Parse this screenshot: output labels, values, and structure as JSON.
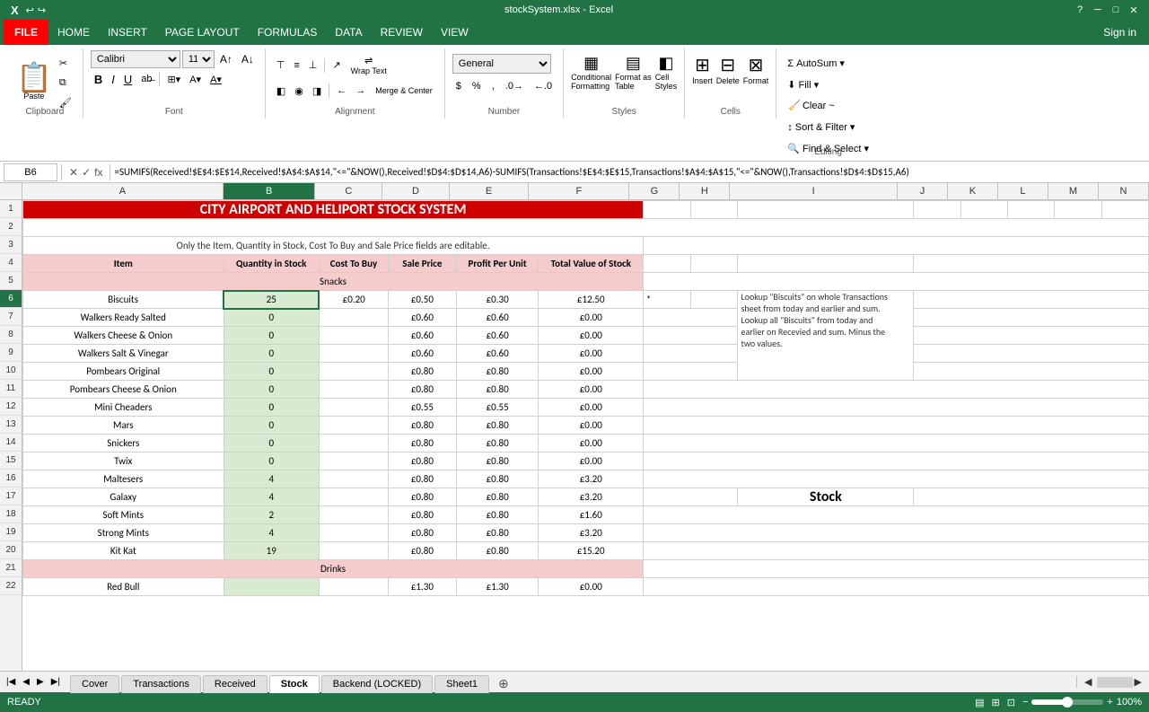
{
  "titleBar": {
    "title": "stockSystem.xlsx - Excel",
    "helpBtn": "?",
    "minBtn": "─",
    "maxBtn": "□",
    "closeBtn": "✕"
  },
  "menuBar": {
    "fileBtn": "FILE",
    "items": [
      "HOME",
      "INSERT",
      "PAGE LAYOUT",
      "FORMULAS",
      "DATA",
      "REVIEW",
      "VIEW"
    ],
    "signIn": "Sign in"
  },
  "ribbon": {
    "clipboard": {
      "label": "Clipboard",
      "pasteLabel": "Paste",
      "cutLabel": "✂",
      "copyLabel": "⧉",
      "formatPainterLabel": "🖌"
    },
    "font": {
      "label": "Font",
      "fontName": "Calibri",
      "fontSize": "11",
      "boldLabel": "B",
      "italicLabel": "I",
      "underlineLabel": "U",
      "strikeLabel": "ab"
    },
    "alignment": {
      "label": "Alignment",
      "wrapText": "Wrap Text",
      "mergeCenter": "Merge & Center"
    },
    "number": {
      "label": "Number",
      "format": "General"
    },
    "styles": {
      "label": "Styles",
      "conditionalFormatting": "Conditional Formatting",
      "formatAsTable": "Format as Table",
      "cellStyles": "Cell Styles"
    },
    "cells": {
      "label": "Cells",
      "insert": "Insert",
      "delete": "Delete",
      "format": "Format"
    },
    "editing": {
      "label": "Editing",
      "autoSum": "AutoSum",
      "fill": "Fill",
      "clear": "Clear ~",
      "sortFilter": "Sort & Filter",
      "findSelect": "Find & Select"
    }
  },
  "formulaBar": {
    "cellRef": "B6",
    "formula": "=SUMIFS(Received!$E$4:$E$14,Received!$A$4:$A$14,\"<=\"&NOW(),Received!$D$4:$D$14,A6)-SUMIFS(Transactions!$E$4:$E$15,Transactions!$A$4:$A$15,\"<=\"&NOW(),Transactions!$D$4:$D$15,A6)"
  },
  "columns": {
    "headers": [
      "A",
      "B",
      "C",
      "D",
      "E",
      "F",
      "G",
      "H",
      "I",
      "J",
      "K",
      "L",
      "M",
      "N"
    ],
    "widths": [
      240,
      110,
      80,
      80,
      95,
      120,
      60,
      60,
      200,
      60,
      60,
      60,
      60,
      60
    ]
  },
  "spreadsheet": {
    "title": "CITY AIRPORT AND HELIPORT STOCK SYSTEM",
    "subtitle": "Only the Item, Quantity in Stock, Cost To Buy and Sale Price fields are editable.",
    "columnHeaders": {
      "item": "Item",
      "quantityInStock": "Quantity in Stock",
      "costToBuy": "Cost To Buy",
      "salePrice": "Sale Price",
      "profitPerUnit": "Profit Per Unit",
      "totalValueOfStock": "Total Value of Stock"
    },
    "sections": {
      "snacks": "Snacks",
      "drinks": "Drinks"
    },
    "rows": [
      {
        "item": "Biscuits",
        "qty": "25",
        "cost": "£0.20",
        "sale": "£0.50",
        "profit": "£0.30",
        "total": "£12.50",
        "isSelected": true
      },
      {
        "item": "Walkers Ready Salted",
        "qty": "0",
        "cost": "",
        "sale": "£0.60",
        "profit": "£0.60",
        "total": "£0.00"
      },
      {
        "item": "Walkers Cheese & Onion",
        "qty": "0",
        "cost": "",
        "sale": "£0.60",
        "profit": "£0.60",
        "total": "£0.00"
      },
      {
        "item": "Walkers Salt & Vinegar",
        "qty": "0",
        "cost": "",
        "sale": "£0.60",
        "profit": "£0.60",
        "total": "£0.00"
      },
      {
        "item": "Pombears Original",
        "qty": "0",
        "cost": "",
        "sale": "£0.80",
        "profit": "£0.80",
        "total": "£0.00"
      },
      {
        "item": "Pombears Cheese & Onion",
        "qty": "0",
        "cost": "",
        "sale": "£0.80",
        "profit": "£0.80",
        "total": "£0.00"
      },
      {
        "item": "Mini Cheaders",
        "qty": "0",
        "cost": "",
        "sale": "£0.55",
        "profit": "£0.55",
        "total": "£0.00"
      },
      {
        "item": "Mars",
        "qty": "0",
        "cost": "",
        "sale": "£0.80",
        "profit": "£0.80",
        "total": "£0.00"
      },
      {
        "item": "Snickers",
        "qty": "0",
        "cost": "",
        "sale": "£0.80",
        "profit": "£0.80",
        "total": "£0.00"
      },
      {
        "item": "Twix",
        "qty": "0",
        "cost": "",
        "sale": "£0.80",
        "profit": "£0.80",
        "total": "£0.00"
      },
      {
        "item": "Maltesers",
        "qty": "4",
        "cost": "",
        "sale": "£0.80",
        "profit": "£0.80",
        "total": "£3.20"
      },
      {
        "item": "Galaxy",
        "qty": "4",
        "cost": "",
        "sale": "£0.80",
        "profit": "£0.80",
        "total": "£3.20"
      },
      {
        "item": "Soft Mints",
        "qty": "2",
        "cost": "",
        "sale": "£0.80",
        "profit": "£0.80",
        "total": "£1.60"
      },
      {
        "item": "Strong Mints",
        "qty": "4",
        "cost": "",
        "sale": "£0.80",
        "profit": "£0.80",
        "total": "£3.20"
      },
      {
        "item": "Kit Kat",
        "qty": "19",
        "cost": "",
        "sale": "£0.80",
        "profit": "£0.80",
        "total": "£15.20"
      },
      {
        "item": "Red Bull",
        "qty": "",
        "cost": "",
        "sale": "£1.30",
        "profit": "£1.30",
        "total": "£0.00"
      }
    ],
    "note": {
      "marker": "*",
      "text": "Lookup \"Biscuits\" on whole Transactions sheet from today and earlier and sum. Lookup all \"Biscuits\" from today and earlier on Recevied and sum. Minus the two values."
    },
    "stockLabel": "Stock"
  },
  "sheets": {
    "tabs": [
      "Cover",
      "Transactions",
      "Received",
      "Stock",
      "Backend (LOCKED)",
      "Sheet1"
    ],
    "activeTab": "Stock",
    "addBtn": "+"
  },
  "statusBar": {
    "status": "READY",
    "zoom": "100%",
    "viewBtns": [
      "▤",
      "⊞",
      "⊡"
    ]
  }
}
